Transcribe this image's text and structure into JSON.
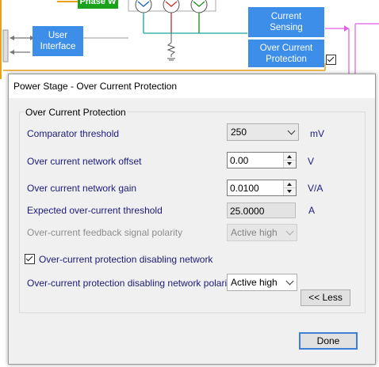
{
  "diagram": {
    "phase_block_label": "Phase W",
    "user_interface_label": "User\nInterface",
    "current_sensing_label": "Current\nSensing",
    "over_current_block_label": "Over Current\nProtection",
    "over_current_block_checked": true
  },
  "dialog": {
    "title": "Power Stage - Over Current Protection",
    "group_title": "Over Current Protection",
    "comparator_threshold": {
      "label": "Comparator threshold",
      "value": "250",
      "unit": "mV"
    },
    "network_offset": {
      "label": "Over current network offset",
      "value": "0.00",
      "unit": "V"
    },
    "network_gain": {
      "label": "Over current network gain",
      "value": "0.0100",
      "unit": "V/A"
    },
    "expected_threshold": {
      "label": "Expected over-current threshold",
      "value": "25.0000",
      "unit": "A"
    },
    "feedback_polarity": {
      "label": "Over-current feedback signal polarity",
      "value": "Active high",
      "enabled": false
    },
    "disabling_network": {
      "label": "Over-current protection disabling network",
      "checked": true
    },
    "disabling_polarity": {
      "label": "Over-current protection disabling network polarity",
      "value": "Active high"
    },
    "less_button_label": "<< Less",
    "done_button_label": "Done"
  },
  "colors": {
    "block_blue": "#3d8ee8",
    "block_green": "#1aa31a",
    "label_navy": "#1b1b7a",
    "wire_teal": "#1aa39a",
    "wire_red": "#c0302c",
    "wire_green": "#1a8a1a",
    "wire_magenta": "#e060e0",
    "wire_orange": "#e8a11a",
    "default_button_border": "#3c7fd6"
  }
}
